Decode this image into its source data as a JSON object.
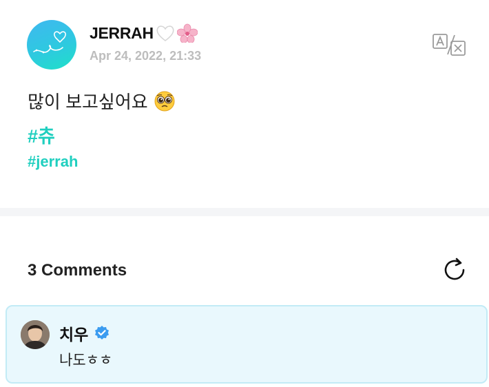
{
  "post": {
    "author": "JERRAH",
    "author_emojis": [
      "white-heart-emoji",
      "cherry-blossom-emoji"
    ],
    "date": "Apr 24, 2022, 21:33",
    "text": "많이 보고싶어요",
    "text_emoji": "pleading-face-emoji",
    "hashtags": [
      "#츄",
      "#jerrah"
    ],
    "translate_icon": "translate-icon"
  },
  "comments": {
    "title": "3 Comments",
    "refresh_icon": "refresh-icon",
    "items": [
      {
        "author": "치우",
        "verified": true,
        "text": "나도ㅎㅎ"
      }
    ]
  },
  "colors": {
    "hashtag": "#1fcfbf",
    "date": "#bdbdbd",
    "comment_bg": "#e9f8fd",
    "comment_border": "#c2ebf6",
    "verified": "#3b9cf0"
  }
}
